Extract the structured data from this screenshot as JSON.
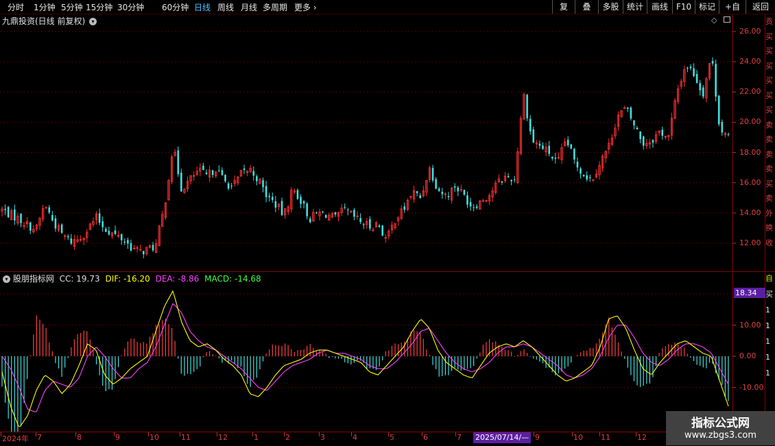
{
  "toolbar": {
    "periods": [
      "分时",
      "1分钟",
      "5分钟",
      "15分钟",
      "30分钟",
      "60分钟",
      "日线",
      "周线",
      "月线",
      "多周期",
      "更多"
    ],
    "active_period": "日线",
    "right_buttons": [
      "复权",
      "叠加",
      "多股",
      "统计",
      "画线",
      "F10",
      "标记",
      "+自选",
      "返回"
    ]
  },
  "main_pane": {
    "title": "九鼎投资(日线 前复权)",
    "y_ticks": [
      "26.00",
      "24.00",
      "22.00",
      "20.00",
      "18.00",
      "16.00",
      "14.00",
      "12.00"
    ]
  },
  "macd_pane": {
    "name": "股朋指标网",
    "cc_label": "CC: 19.73",
    "dif_label": "DIF: -16.20",
    "dea_label": "DEA: -8.86",
    "macd_label": "MACD: -14.68",
    "y_ticks": [
      "10.00",
      "0.00",
      "-10.00"
    ],
    "current_badge": "18.34",
    "colors": {
      "dif": "#ffff00",
      "dea": "#ff40ff",
      "up_bar": "#ff4040",
      "down_bar": "#40e0e0",
      "macd_label": "#40ff40"
    }
  },
  "x_axis": {
    "labels": [
      "2024年",
      "7",
      "8",
      "9",
      "10",
      "11",
      "12",
      "1",
      "2",
      "3",
      "4",
      "5",
      "6",
      "7",
      "9",
      "10",
      "11",
      "12"
    ],
    "cursor_date": "2025/07/14/—"
  },
  "side_panel_fragment": [
    "贡",
    "买",
    "买",
    "买",
    "买",
    "买",
    "买",
    "卖",
    "卖",
    "卖",
    "卖",
    "买",
    "卖",
    "外",
    "换",
    "收"
  ],
  "side_panel_fragment2": [
    "自",
    "买",
    "1",
    "1",
    "1",
    "1",
    "1"
  ],
  "watermark": {
    "title": "指标公式网",
    "url": "www.zbgs3.com"
  },
  "chart_data": [
    {
      "type": "candlestick",
      "title": "九鼎投资(日线 前复权)",
      "ylim": [
        10.5,
        27
      ],
      "x_labels": [
        "2024年",
        "7",
        "8",
        "9",
        "10",
        "11",
        "12",
        "1",
        "2",
        "3",
        "4",
        "5",
        "6",
        "7",
        "9",
        "10",
        "11",
        "12"
      ],
      "close_path": [
        14.2,
        13.9,
        13.6,
        13.2,
        12.9,
        14.6,
        13.4,
        12.6,
        12.1,
        12.3,
        12.9,
        13.7,
        13.0,
        12.6,
        12.3,
        11.8,
        11.4,
        11.6,
        11.8,
        14.4,
        18.4,
        15.6,
        16.2,
        16.8,
        16.4,
        17.0,
        16.1,
        15.7,
        16.6,
        16.9,
        16.2,
        15.1,
        14.6,
        13.8,
        15.6,
        14.8,
        13.6,
        14.0,
        13.9,
        13.6,
        14.2,
        13.8,
        13.4,
        13.1,
        13.3,
        12.2,
        13.6,
        14.2,
        15.4,
        15.0,
        17.0,
        15.6,
        15.1,
        15.8,
        15.2,
        14.4,
        14.8,
        15.2,
        16.0,
        16.4,
        16.2,
        22.0,
        18.8,
        18.4,
        18.0,
        17.2,
        18.9,
        17.4,
        16.6,
        16.2,
        17.4,
        18.4,
        20.4,
        20.9,
        19.8,
        18.6,
        18.8,
        19.4,
        19.0,
        22.0,
        23.8,
        23.2,
        21.8,
        24.5,
        19.6,
        18.9
      ]
    },
    {
      "type": "line+bar",
      "title": "股朋指标网",
      "ylim": [
        -24,
        23
      ],
      "series": [
        {
          "name": "DIF",
          "values": [
            -5,
            -16,
            -23,
            -19,
            -11,
            -6,
            -8,
            -12,
            -9,
            -3,
            4,
            2,
            -6,
            -9,
            -7,
            -4,
            -2,
            0,
            8,
            16,
            21,
            11,
            5,
            3,
            4,
            2,
            -1,
            -3,
            -6,
            -12,
            -13,
            -10,
            -6,
            -3,
            -2,
            -1,
            1,
            2,
            2,
            1,
            0,
            -1,
            -2,
            -5,
            -6,
            -3,
            0,
            3,
            8,
            12,
            9,
            2,
            -2,
            -4,
            -6,
            -7,
            -3,
            1,
            3,
            4,
            3,
            5,
            3,
            0,
            -3,
            -6,
            -8,
            -7,
            -5,
            -3,
            3,
            12,
            13,
            9,
            2,
            -4,
            -6,
            -2,
            1,
            4,
            5,
            3,
            1,
            0,
            -8,
            -16
          ]
        },
        {
          "name": "DEA",
          "values": [
            0,
            -4,
            -10,
            -17,
            -18,
            -11,
            -8,
            -9,
            -10,
            -7,
            0,
            3,
            0,
            -4,
            -7,
            -7,
            -4,
            -2,
            3,
            10,
            17,
            14,
            8,
            5,
            3,
            2,
            0,
            -2,
            -4,
            -7,
            -10,
            -11,
            -8,
            -5,
            -3,
            -2,
            -1,
            1,
            2,
            1,
            1,
            0,
            -1,
            -3,
            -4,
            -4,
            -2,
            1,
            4,
            8,
            9,
            5,
            1,
            -2,
            -4,
            -5,
            -4,
            -2,
            1,
            3,
            3,
            4,
            3,
            1,
            -1,
            -3,
            -6,
            -7,
            -6,
            -4,
            0,
            6,
            10,
            10,
            6,
            1,
            -2,
            -3,
            -1,
            2,
            4,
            4,
            3,
            1,
            -4,
            -9
          ]
        },
        {
          "name": "MACD",
          "values": [
            -10,
            -24,
            -26,
            -6,
            14,
            10,
            0,
            -6,
            2,
            8,
            8,
            -2,
            -12,
            -10,
            0,
            6,
            4,
            4,
            10,
            12,
            8,
            -6,
            -6,
            -4,
            2,
            0,
            -2,
            -2,
            -4,
            -10,
            -6,
            2,
            4,
            4,
            2,
            2,
            4,
            2,
            0,
            0,
            -2,
            -2,
            -2,
            -4,
            -4,
            2,
            4,
            4,
            8,
            8,
            0,
            -6,
            -6,
            -4,
            -4,
            -4,
            2,
            6,
            4,
            2,
            0,
            2,
            0,
            -2,
            -4,
            -6,
            -4,
            0,
            2,
            2,
            6,
            12,
            6,
            -2,
            -8,
            -10,
            -8,
            2,
            4,
            4,
            2,
            -2,
            -4,
            -2,
            -8,
            -15
          ]
        }
      ]
    }
  ]
}
